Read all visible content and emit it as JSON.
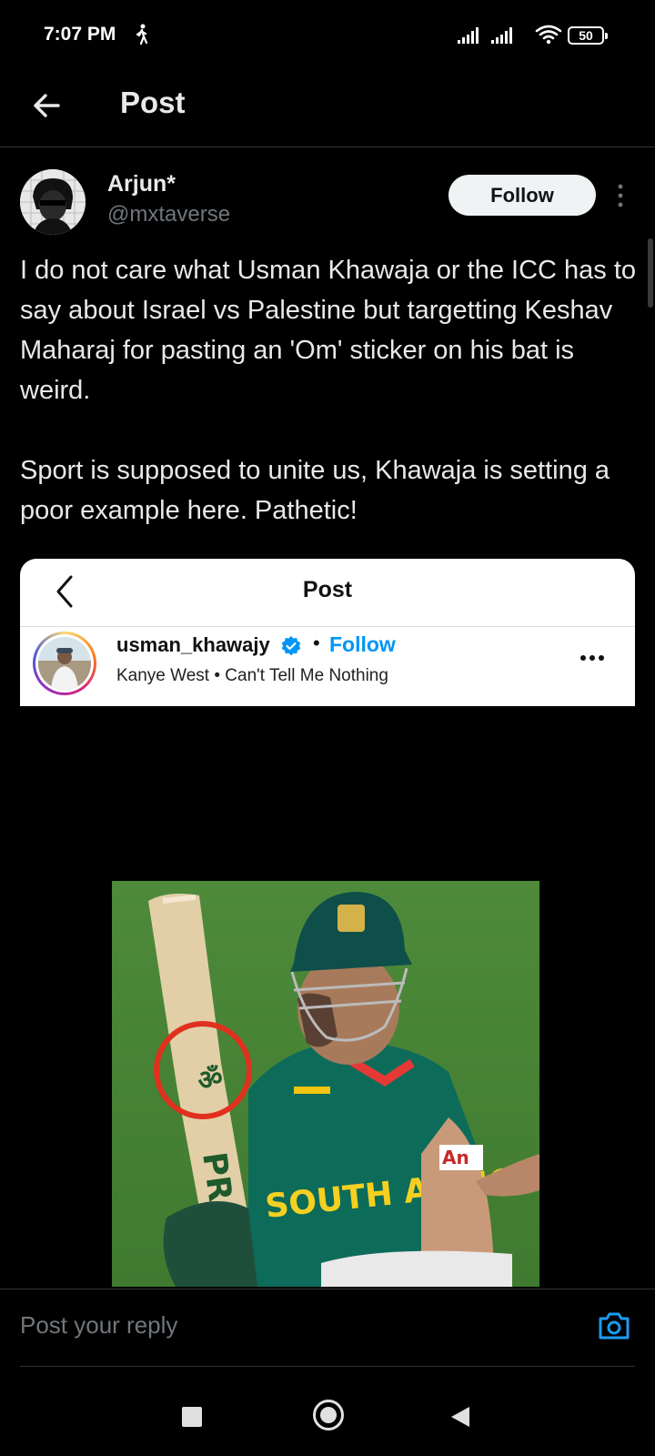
{
  "status_bar": {
    "time": "7:07 PM",
    "battery": "50",
    "icons": [
      "walk-icon",
      "signal-icon",
      "signal-icon",
      "wifi-icon",
      "battery-icon"
    ]
  },
  "header": {
    "back_icon": "arrow-left-icon",
    "title": "Post"
  },
  "post": {
    "author_name": "Arjun*",
    "author_handle": "@mxtaverse",
    "follow_label": "Follow",
    "more_icon": "more-vertical-icon",
    "paragraphs": [
      "I do not care what Usman Khawaja or the ICC has to say about Israel vs Palestine but targetting Keshav Maharaj for pasting an 'Om' sticker on his bat is weird.",
      "Sport is supposed to unite us, Khawaja is setting a poor example here. Pathetic!"
    ]
  },
  "embed": {
    "title": "Post",
    "username": "usman_khawajy",
    "dot": "•",
    "follow_label": "Follow",
    "music": "Kanye West • Can't Tell Me Nothing",
    "photo": {
      "bat_text": "PR",
      "jersey_text": "SOUTH AFRICA",
      "sponsor_text": "An"
    }
  },
  "reply": {
    "placeholder": "Post your reply",
    "camera_icon": "camera-icon"
  },
  "nav": {
    "icons": [
      "recents-icon",
      "home-icon",
      "back-icon"
    ]
  }
}
